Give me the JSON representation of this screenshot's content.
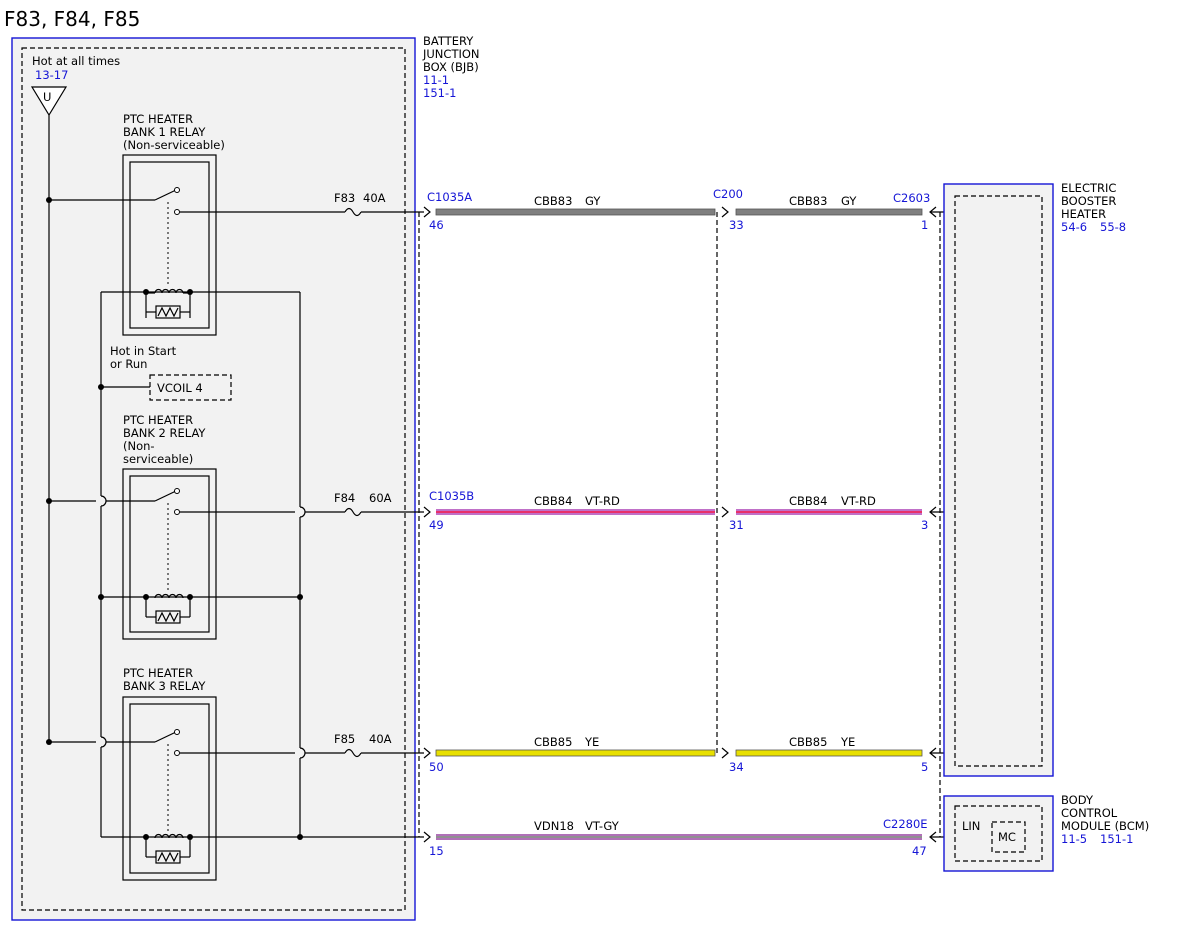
{
  "page_title": "F83, F84, F85",
  "power": {
    "label": "Hot at all times",
    "ref": "13-17",
    "symbol": "U"
  },
  "start_run": {
    "label_line1": "Hot in Start",
    "label_line2": "or Run",
    "vcoil": "VCOIL 4"
  },
  "relays": [
    {
      "lines": [
        "PTC HEATER",
        "BANK 1 RELAY",
        "(Non-serviceable)"
      ]
    },
    {
      "lines": [
        "PTC HEATER",
        "BANK 2 RELAY",
        "(Non-",
        "serviceable)"
      ]
    },
    {
      "lines": [
        "PTC HEATER",
        "BANK 3 RELAY"
      ]
    }
  ],
  "fuses": [
    {
      "name": "F83",
      "rating": "40A"
    },
    {
      "name": "F84",
      "rating": "60A"
    },
    {
      "name": "F85",
      "rating": "40A"
    }
  ],
  "bjb": {
    "lines": [
      "BATTERY",
      "JUNCTION",
      "BOX (BJB)"
    ],
    "refs": [
      "11-1",
      "151-1"
    ]
  },
  "heater": {
    "lines": [
      "ELECTRIC",
      "BOOSTER",
      "HEATER"
    ],
    "ref1": "54-6",
    "ref2": "55-8"
  },
  "bcm": {
    "lines": [
      "BODY",
      "CONTROL",
      "MODULE (BCM)"
    ],
    "ref1": "11-5",
    "ref2": "151-1",
    "lin": "LIN",
    "mc": "MC"
  },
  "connectors": {
    "c1035a": "C1035A",
    "c1035b": "C1035B",
    "c200": "C200",
    "c2603": "C2603",
    "c2280e": "C2280E"
  },
  "circuits": [
    {
      "circuit": "CBB83",
      "color": "GY",
      "hex": "#808080",
      "stripe": null,
      "pin_bjb": "46",
      "pin_c200_in": "33",
      "pin_dest": "1"
    },
    {
      "circuit": "CBB84",
      "color": "VT-RD",
      "hex": "#c060c0",
      "stripe": "#e8306a",
      "pin_bjb": "49",
      "pin_c200_in": "31",
      "pin_dest": "3"
    },
    {
      "circuit": "CBB85",
      "color": "YE",
      "hex": "#e8e000",
      "stripe": null,
      "pin_bjb": "50",
      "pin_c200_in": "34",
      "pin_dest": "5"
    },
    {
      "circuit": "VDN18",
      "color": "VT-GY",
      "hex": "#b070b8",
      "stripe": "#909090",
      "pin_bjb": "15",
      "pin_dest": "47"
    }
  ]
}
